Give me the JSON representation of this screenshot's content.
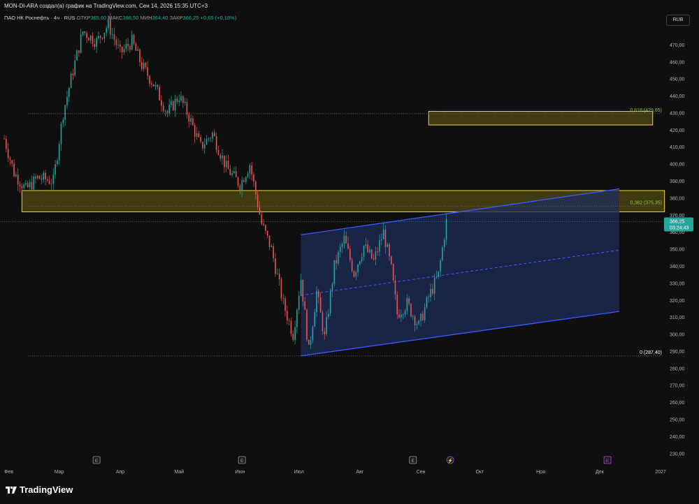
{
  "header": {
    "title": "MON-DI-ARA создал(а) график на TradingView.com, Сен 14, 2026 15:35 UTC+3"
  },
  "legend": {
    "symbol": "ПАО НК Роснефть · 4ч · RUS",
    "open_label": "ОТКР",
    "open_value": "365,60",
    "high_label": "МАКС",
    "high_value": "366,50",
    "low_label": "МИН",
    "low_value": "364,40",
    "close_label": "ЗАКР",
    "close_value": "366,25",
    "change": "+0,65 (+0,18%)"
  },
  "currency": "RUB",
  "brand": {
    "name": "TradingView"
  },
  "colors": {
    "up": "#26a69a",
    "down": "#ef5350",
    "channel_fill": "#1e2c59",
    "channel_line": "#3d5afe",
    "zone_fill": "#524a12",
    "zone_border": "#e8d64a",
    "price_badge": "#26a69a"
  },
  "chart_data": {
    "type": "candlestick",
    "y_axis_ticks": [
      "470,00",
      "460,00",
      "450,00",
      "440,00",
      "430,00",
      "420,00",
      "410,00",
      "400,00",
      "390,00",
      "380,00",
      "370,00",
      "360,00",
      "350,00",
      "340,00",
      "330,00",
      "320,00",
      "310,00",
      "300,00",
      "290,00",
      "280,00",
      "270,00",
      "260,00",
      "250,00",
      "240,00",
      "230,00"
    ],
    "y_range": [
      225,
      480
    ],
    "x_axis_labels": [
      "Фев",
      "Мар",
      "Апр",
      "Май",
      "Июн",
      "Июл",
      "Авг",
      "Сен",
      "Окт",
      "Ноя",
      "Дек",
      "2027"
    ],
    "x_range": [
      "2026-02-01",
      "2027-01-01"
    ],
    "current_price": {
      "value": "366,25",
      "countdown": "03:24:43"
    },
    "fib_levels": [
      {
        "label": "0,618 (429,65)",
        "value": 429.65
      },
      {
        "label": "0,382 (375,35)",
        "value": 375.35
      },
      {
        "label": "0 (287,40)",
        "value": 287.4
      }
    ],
    "zones": [
      {
        "from": "2026-09-05",
        "to": "2026-12-28",
        "low": 423,
        "high": 431
      },
      {
        "from": "2026-02-10",
        "to": "2027-01-03",
        "low": 372,
        "high": 384.5
      }
    ],
    "channel": {
      "start": "2026-07-02",
      "end": "2026-12-11",
      "lower": [
        287.4,
        313.5
      ],
      "upper": [
        358.5,
        385.5
      ]
    },
    "event_markers": [
      "E",
      "E",
      "E",
      "⚡",
      "E"
    ],
    "close_path": [
      [
        "2026-02-01",
        415
      ],
      [
        "2026-02-06",
        395
      ],
      [
        "2026-02-12",
        385
      ],
      [
        "2026-02-18",
        392
      ],
      [
        "2026-02-26",
        390
      ],
      [
        "2026-03-03",
        430
      ],
      [
        "2026-03-08",
        455
      ],
      [
        "2026-03-13",
        478
      ],
      [
        "2026-03-20",
        472
      ],
      [
        "2026-03-26",
        482
      ],
      [
        "2026-04-01",
        465
      ],
      [
        "2026-04-07",
        472
      ],
      [
        "2026-04-12",
        458
      ],
      [
        "2026-04-18",
        447
      ],
      [
        "2026-04-25",
        430
      ],
      [
        "2026-05-01",
        440
      ],
      [
        "2026-05-06",
        428
      ],
      [
        "2026-05-12",
        410
      ],
      [
        "2026-05-18",
        418
      ],
      [
        "2026-05-25",
        398
      ],
      [
        "2026-06-01",
        388
      ],
      [
        "2026-06-06",
        400
      ],
      [
        "2026-06-12",
        365
      ],
      [
        "2026-06-17",
        350
      ],
      [
        "2026-06-23",
        318
      ],
      [
        "2026-06-28",
        300
      ],
      [
        "2026-07-02",
        333
      ],
      [
        "2026-07-06",
        290
      ],
      [
        "2026-07-10",
        325
      ],
      [
        "2026-07-14",
        298
      ],
      [
        "2026-07-19",
        340
      ],
      [
        "2026-07-24",
        356
      ],
      [
        "2026-07-29",
        336
      ],
      [
        "2026-08-03",
        352
      ],
      [
        "2026-08-08",
        343
      ],
      [
        "2026-08-13",
        360
      ],
      [
        "2026-08-17",
        338
      ],
      [
        "2026-08-20",
        312
      ],
      [
        "2026-08-25",
        318
      ],
      [
        "2026-08-31",
        305
      ],
      [
        "2026-09-05",
        322
      ],
      [
        "2026-09-10",
        335
      ],
      [
        "2026-09-14",
        366.25
      ]
    ]
  }
}
